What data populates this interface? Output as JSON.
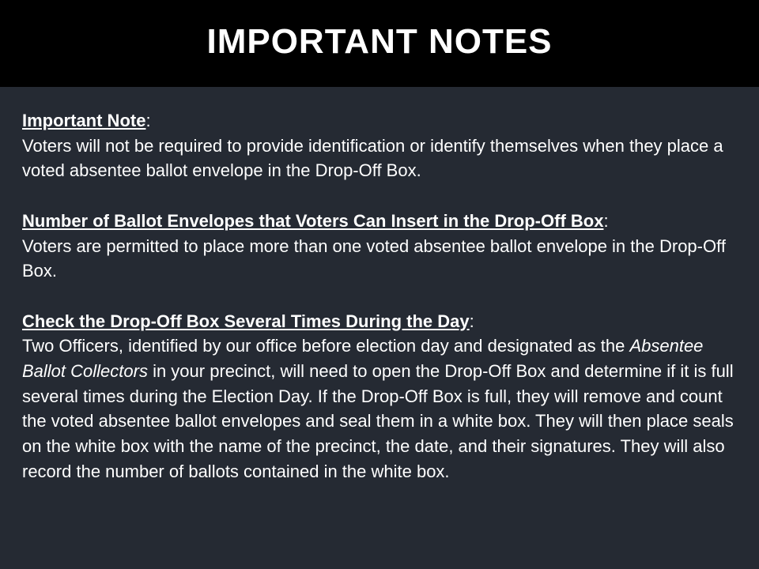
{
  "title": "IMPORTANT NOTES",
  "sections": [
    {
      "heading": "Important Note",
      "colon": ":",
      "text": "Voters will not be required to provide identification or identify themselves when they place a voted absentee ballot envelope in the Drop-Off Box."
    },
    {
      "heading": "Number of Ballot Envelopes that Voters Can Insert in the Drop-Off Box",
      "colon": ":",
      "text": "Voters are permitted to place more than one voted absentee ballot envelope in the Drop-Off Box."
    },
    {
      "heading": "Check the Drop-Off Box Several Times During the Day",
      "colon": ":",
      "text_before": "Two Officers, identified by our office before election day and designated as the ",
      "text_italic": "Absentee Ballot Collectors",
      "text_after": " in your precinct, will need to open the Drop-Off Box and determine if it is full several times during the Election Day. If the Drop-Off Box is full, they will remove and count the voted absentee ballot envelopes and seal them in a white box. They will then place seals on the white box with the name of the precinct, the date, and their signatures. They will also record the number of ballots contained in the white box."
    }
  ],
  "colors": {
    "title_bar": "#000000",
    "background": "#252a33",
    "text": "#ffffff"
  }
}
